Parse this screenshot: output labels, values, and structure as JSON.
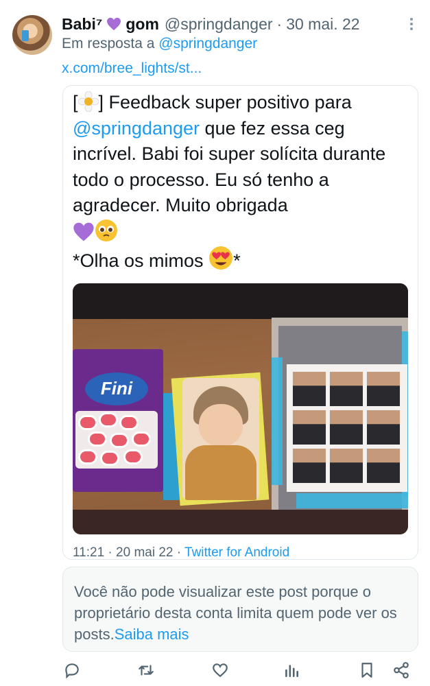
{
  "tweet": {
    "author_name": "Babi⁷",
    "author_suffix": "gom",
    "handle": "@springdanger",
    "separator": "·",
    "date": "30 mai. 22",
    "reply_prefix": "Em resposta a",
    "reply_handle": "@springdanger",
    "link": "x.com/bree_lights/st..."
  },
  "quoted": {
    "text_part1": "[",
    "text_part2": "] Feedback super positivo para",
    "mention": "@springdanger",
    "text_part3": "que fez essa ceg incrível. Babi foi super solícita durante todo o processo. Eu só tenho a agradecer. Muito obrigada",
    "text_part4": "*Olha os mimos",
    "text_part5": "*",
    "photo_brand": "Fini",
    "time": "11:21",
    "separator": "·",
    "date": "20 mai 22",
    "source_separator": "·",
    "source": "Twitter for Android"
  },
  "notice": {
    "text": "Você não pode visualizar este post porque o proprietário desta conta limita quem pode ver os posts.",
    "learn_more": "Saiba mais"
  },
  "colors": {
    "accent": "#1d9bf0",
    "secondary_text": "#536471",
    "heart": "#a56bd6"
  },
  "icons": [
    "reply-icon",
    "retweet-icon",
    "like-icon",
    "views-icon",
    "bookmark-icon",
    "share-icon",
    "more-icon"
  ]
}
